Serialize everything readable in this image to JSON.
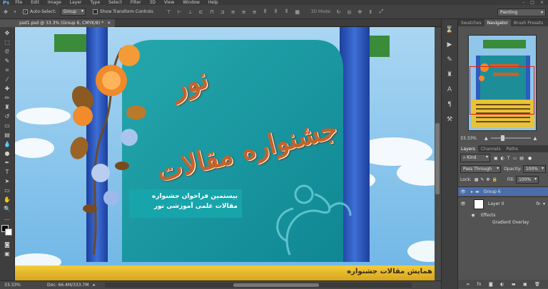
{
  "app": {
    "logo": "Ps",
    "workspace": "Painting"
  },
  "menu": [
    "File",
    "Edit",
    "Image",
    "Layer",
    "Type",
    "Select",
    "Filter",
    "3D",
    "View",
    "Window",
    "Help"
  ],
  "options_bar": {
    "auto_select_label": "Auto-Select:",
    "auto_select_value": "Group",
    "show_transform_label": "Show Transform Controls",
    "mode_3d_label": "3D Mode:"
  },
  "document": {
    "tab_title": "psd1.psd @ 33.3% (Group 6, CMYK/8) *",
    "close": "×"
  },
  "status": {
    "zoom": "33.33%",
    "doc_info": "Doc: 66.4M/333.7M"
  },
  "artwork": {
    "title_line1": "نور",
    "title_line2": "جشنواره مقالات",
    "subtitle_line1": "بیستمین فراخوان جشنواره",
    "subtitle_line2": "مقالات علمی آموزشی نور",
    "bottom_text": "همایش مقالات جشنواره"
  },
  "panels": {
    "top_tabs": [
      "Swatches",
      "Navigator",
      "Brush Presets"
    ],
    "nav_zoom": "33.33%",
    "layer_tabs": [
      "Layers",
      "Channels",
      "Paths"
    ],
    "kind_label": "Kind",
    "blend_mode": "Pass Through",
    "opacity_label": "Opacity:",
    "opacity_value": "100%",
    "lock_label": "Lock:",
    "fill_label": "Fill:",
    "fill_value": "100%",
    "layers": [
      {
        "name": "Group 6",
        "type": "group"
      },
      {
        "name": "Layer 0",
        "type": "layer",
        "fx": "fx"
      }
    ],
    "effects_label": "Effects",
    "effect_item": "Gradient Overlay"
  }
}
